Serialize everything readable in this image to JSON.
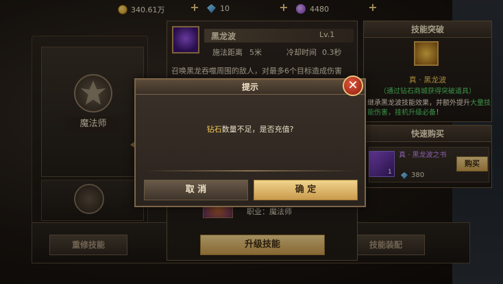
{
  "currency": {
    "gold": "340.61万",
    "diamond": "10",
    "crystal": "4480"
  },
  "left_panel": {
    "class_name": "魔法师",
    "reset_button": "重修技能"
  },
  "skill": {
    "name": "黑龙波",
    "level": "Lv.1",
    "range_label": "施法距离",
    "range_value": "5米",
    "cooldown_label": "冷却时间",
    "cooldown_value": "0.3秒",
    "description": "召唤黑龙吞噬周围的敌人，对最多6个目标造成伤害",
    "job_label": "职业：魔法师",
    "upgrade_button": "升级技能",
    "equip_button": "技能装配"
  },
  "breakthrough": {
    "title": "技能突破",
    "skill_name": "真 · 黑龙波",
    "obtain_hint": "（通过钻石商城获得突破道具）",
    "desc_prefix": "继承黑龙波技能效果，并额外提升",
    "desc_highlight": "大量技能伤害，挂机升级必备",
    "desc_suffix": "！"
  },
  "quick_buy": {
    "title": "快速购买",
    "item_name": "真 · 黑龙波之书",
    "item_count": "1",
    "price": "380",
    "buy_button": "购买"
  },
  "modal": {
    "title": "提示",
    "message_highlight": "钻石",
    "message_rest": "数量不足，是否充值?",
    "cancel": "取 消",
    "confirm": "确 定",
    "close": "✕"
  }
}
